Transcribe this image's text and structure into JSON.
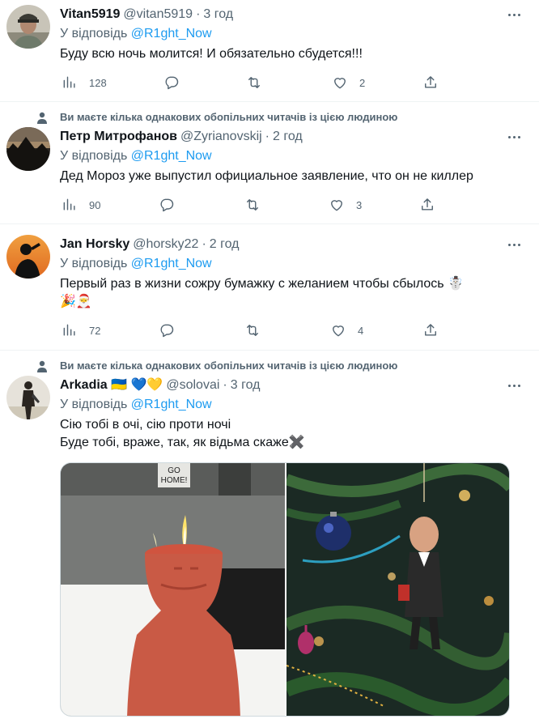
{
  "tweets": [
    {
      "name": "Vitan5919",
      "handle": "@vitan5919",
      "time": "3 год",
      "reply_prefix": "У відповідь",
      "reply_to": "@R1ght_Now",
      "text": "Буду всю ночь молится! И обязательно сбудется!!!",
      "views": "128",
      "likes": "2"
    },
    {
      "social_context": "Ви маєте кілька однакових обопільних читачів із цією людиною",
      "name": "Петр Митрофанов",
      "handle": "@Zyrianovskij",
      "time": "2 год",
      "reply_prefix": "У відповідь",
      "reply_to": "@R1ght_Now",
      "text": "Дед Мороз уже выпустил официальное заявление, что он не киллер",
      "views": "90",
      "likes": "3"
    },
    {
      "name": "Jan Horsky",
      "handle": "@horsky22",
      "time": "2 год",
      "reply_prefix": "У відповідь",
      "reply_to": "@R1ght_Now",
      "text_line1": "Первый раз в жизни сожру бумажку с желанием чтобы сбылось ☃️",
      "text_line2": "🎉🎅",
      "views": "72",
      "likes": "4"
    },
    {
      "social_context": "Ви маєте кілька однакових обопільних читачів із цією людиною",
      "name": "Arkadia 🇺🇦 💙💛",
      "handle": "@solovai",
      "time": "3 год",
      "reply_prefix": "У відповідь",
      "reply_to": "@R1ght_Now",
      "text_line1": "Сію тобі в очі, сію проти ночі",
      "text_line2": "Буде тобі, враже, так, як відьма скаже✖️",
      "sign_text_1": "GO",
      "sign_text_2": "HOME!"
    }
  ],
  "icons": {
    "views": "bar-chart-icon",
    "reply": "reply-bubble-icon",
    "retweet": "retweet-icon",
    "like": "heart-icon",
    "share": "share-upload-icon",
    "more": "more-dots-icon",
    "social": "person-icon"
  },
  "colors": {
    "accent": "#1d9bf0",
    "secondary_text": "#536471",
    "divider": "#eff3f4"
  }
}
